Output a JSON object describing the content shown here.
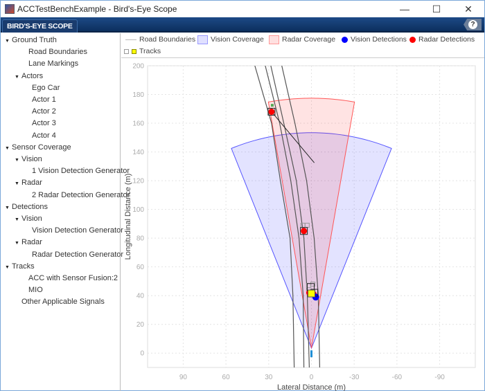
{
  "window": {
    "title": "ACCTestBenchExample - Bird's-Eye Scope",
    "minimize": "—",
    "maximize": "☐",
    "close": "✕"
  },
  "toolstrip": {
    "tab": "BIRD'S-EYE SCOPE",
    "help": "?"
  },
  "sidebar": {
    "items": [
      {
        "label": "Ground Truth",
        "level": 0,
        "expanded": true
      },
      {
        "label": "Road Boundaries",
        "level": 2
      },
      {
        "label": "Lane Markings",
        "level": 2
      },
      {
        "label": "Actors",
        "level": 1,
        "expanded": true
      },
      {
        "label": "Ego Car",
        "level": 3
      },
      {
        "label": "Actor 1",
        "level": 3
      },
      {
        "label": "Actor 2",
        "level": 3
      },
      {
        "label": "Actor 3",
        "level": 3
      },
      {
        "label": "Actor 4",
        "level": 3
      },
      {
        "label": "Sensor Coverage",
        "level": 0,
        "expanded": true
      },
      {
        "label": "Vision",
        "level": 1,
        "expanded": true
      },
      {
        "label": "1 Vision Detection Generator",
        "level": 3
      },
      {
        "label": "Radar",
        "level": 1,
        "expanded": true
      },
      {
        "label": "2 Radar Detection Generator",
        "level": 3
      },
      {
        "label": "Detections",
        "level": 0,
        "expanded": true
      },
      {
        "label": "Vision",
        "level": 1,
        "expanded": true
      },
      {
        "label": "Vision Detection Generator",
        "level": 3
      },
      {
        "label": "Radar",
        "level": 1,
        "expanded": true
      },
      {
        "label": "Radar Detection Generator",
        "level": 3
      },
      {
        "label": "Tracks",
        "level": 0,
        "expanded": true
      },
      {
        "label": "ACC with Sensor Fusion:2",
        "level": 2
      },
      {
        "label": "MIO",
        "level": 2
      },
      {
        "label": "Other Applicable Signals",
        "level": 1
      }
    ]
  },
  "legend": {
    "road": "Road Boundaries",
    "vision_cov": "Vision Coverage",
    "radar_cov": "Radar Coverage",
    "vision_det": "Vision Detections",
    "radar_det": "Radar Detections",
    "tracks": "Tracks"
  },
  "colors": {
    "vision": "#0000ff",
    "radar": "#ff0000",
    "track": "#ffff00",
    "road": "#555555",
    "ego": "#1f8fd6"
  },
  "chart_data": {
    "type": "scatter",
    "xlabel": "Lateral Distance (m)",
    "ylabel": "Longitudinal Distance (m)",
    "xlim": [
      115,
      -115
    ],
    "ylim": [
      -10,
      200
    ],
    "x_reversed": true,
    "grid": true,
    "xticks": [
      90,
      60,
      30,
      0,
      -30,
      -60,
      -90
    ],
    "yticks": [
      0,
      20,
      40,
      60,
      80,
      100,
      120,
      140,
      160,
      180,
      200
    ],
    "road_boundaries": [
      [
        [
          12.1,
          -10
        ],
        [
          13,
          40
        ],
        [
          15,
          80
        ],
        [
          21.8,
          120
        ],
        [
          28,
          160
        ],
        [
          39.7,
          200
        ]
      ],
      [
        [
          5.3,
          -10
        ],
        [
          5.8,
          40
        ],
        [
          8.7,
          80
        ],
        [
          14.5,
          120
        ],
        [
          22.3,
          160
        ],
        [
          32.4,
          200
        ]
      ],
      [
        [
          1.5,
          -10
        ],
        [
          2.9,
          40
        ],
        [
          5.3,
          80
        ],
        [
          10.6,
          120
        ],
        [
          19.4,
          160
        ],
        [
          28.5,
          200
        ]
      ],
      [
        [
          -5.8,
          -10
        ],
        [
          -4.8,
          40
        ],
        [
          -1.9,
          80
        ],
        [
          3.4,
          120
        ],
        [
          11.6,
          160
        ],
        [
          20.8,
          200
        ]
      ]
    ],
    "vision_coverage": {
      "origin": [
        0,
        3.4
      ],
      "range": 150,
      "fov_deg": 44
    },
    "radar_coverage": {
      "origin": [
        0,
        3.4
      ],
      "range": 174,
      "fov_deg": 20
    },
    "ego_car": [
      0,
      0
    ],
    "radar_detections": [
      [
        28,
        168
      ],
      [
        5.3,
        85
      ],
      [
        1.5,
        42
      ],
      [
        -1.5,
        41
      ]
    ],
    "vision_detections": [
      [
        -3,
        39
      ]
    ],
    "tracks": [
      [
        0,
        41.5
      ]
    ],
    "track_outlines": [
      [
        28,
        168
      ],
      [
        5.3,
        85
      ],
      [
        0.5,
        46
      ],
      [
        -2,
        42
      ]
    ],
    "gray_history": [
      [
        6,
        89
      ],
      [
        3,
        89
      ],
      [
        2,
        47
      ],
      [
        -1,
        48
      ]
    ],
    "mio_line": [
      [
        28,
        168
      ],
      [
        -2,
        132.5
      ]
    ]
  }
}
